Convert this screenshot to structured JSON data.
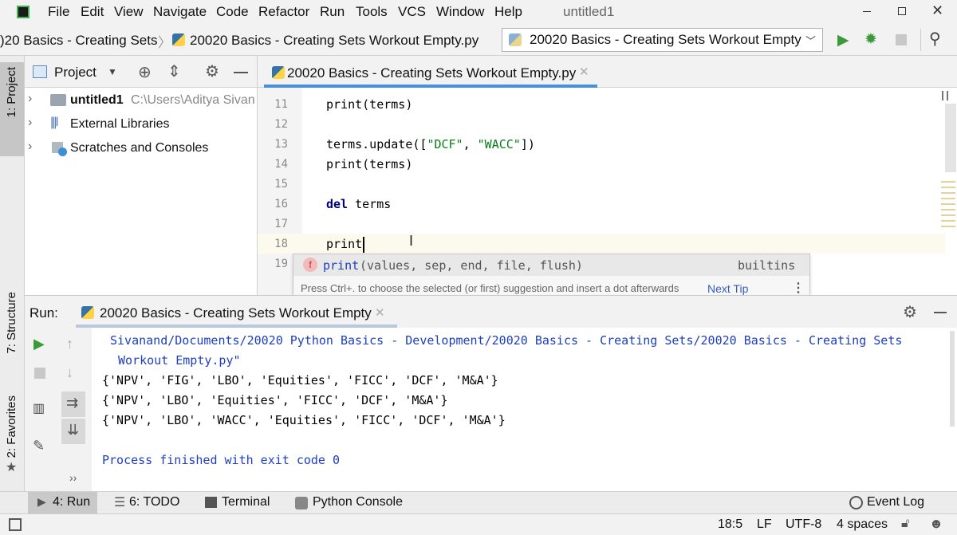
{
  "menubar": {
    "items": [
      "File",
      "Edit",
      "View",
      "Navigate",
      "Code",
      "Refactor",
      "Run",
      "Tools",
      "VCS",
      "Window",
      "Help"
    ],
    "window_title": "untitled1"
  },
  "navbar": {
    "breadcrumb_parent": ")20 Basics - Creating Sets",
    "breadcrumb_file": "20020 Basics - Creating Sets Workout Empty.py",
    "run_config": "20020 Basics - Creating Sets Workout Empty"
  },
  "side_tabs": {
    "project": "1: Project",
    "structure": "7: Structure",
    "favorites": "2: Favorites"
  },
  "project_panel": {
    "title": "Project",
    "items": [
      {
        "name": "untitled1",
        "path": "C:\\Users\\Aditya Sivan"
      },
      {
        "name": "External Libraries"
      },
      {
        "name": "Scratches and Consoles"
      }
    ]
  },
  "editor": {
    "tab_label": "20020 Basics - Creating Sets Workout Empty.py",
    "lines": [
      {
        "num": "11",
        "code": "print(terms)"
      },
      {
        "num": "12",
        "code": ""
      },
      {
        "num": "13",
        "code_pre": "terms.update([",
        "str1": "\"DCF\"",
        "mid": ", ",
        "str2": "\"WACC\"",
        "post": "])"
      },
      {
        "num": "14",
        "code": "print(terms)"
      },
      {
        "num": "15",
        "code": ""
      },
      {
        "num": "16",
        "kw": "del",
        "code": " terms"
      },
      {
        "num": "17",
        "code": ""
      },
      {
        "num": "18",
        "code": "print"
      },
      {
        "num": "19",
        "code": ""
      }
    ]
  },
  "autocomplete": {
    "badge": "f",
    "fn_name": "print",
    "signature": "(values, sep, end, file, flush)",
    "source": "builtins",
    "hint": "Press Ctrl+. to choose the selected (or first) suggestion and insert a dot afterwards",
    "next_tip": "Next Tip"
  },
  "run_panel": {
    "label": "Run:",
    "tab": "20020 Basics - Creating Sets Workout Empty",
    "output": {
      "path_line1": "Sivanand/Documents/20020 Python Basics - Development/20020 Basics - Creating Sets/20020 Basics - Creating Sets",
      "path_line2": "Workout Empty.py\"",
      "set1": "{'NPV', 'FIG', 'LBO', 'Equities', 'FICC', 'DCF', 'M&A'}",
      "set2": "{'NPV', 'LBO', 'Equities', 'FICC', 'DCF', 'M&A'}",
      "set3": "{'NPV', 'LBO', 'WACC', 'Equities', 'FICC', 'DCF', 'M&A'}",
      "exit": "Process finished with exit code 0"
    }
  },
  "bottom_tabs": {
    "run": "4: Run",
    "todo": "6: TODO",
    "terminal": "Terminal",
    "python_console": "Python Console",
    "event_log": "Event Log"
  },
  "status": {
    "position": "18:5",
    "line_sep": "LF",
    "encoding": "UTF-8",
    "indent": "4 spaces"
  },
  "colors": {
    "accent": "#4a90d9",
    "run_green": "#3a9a3a",
    "keyword": "#000080",
    "string": "#067d17",
    "output_blue": "#1d3fbf",
    "caret_line": "#fcfaed"
  }
}
